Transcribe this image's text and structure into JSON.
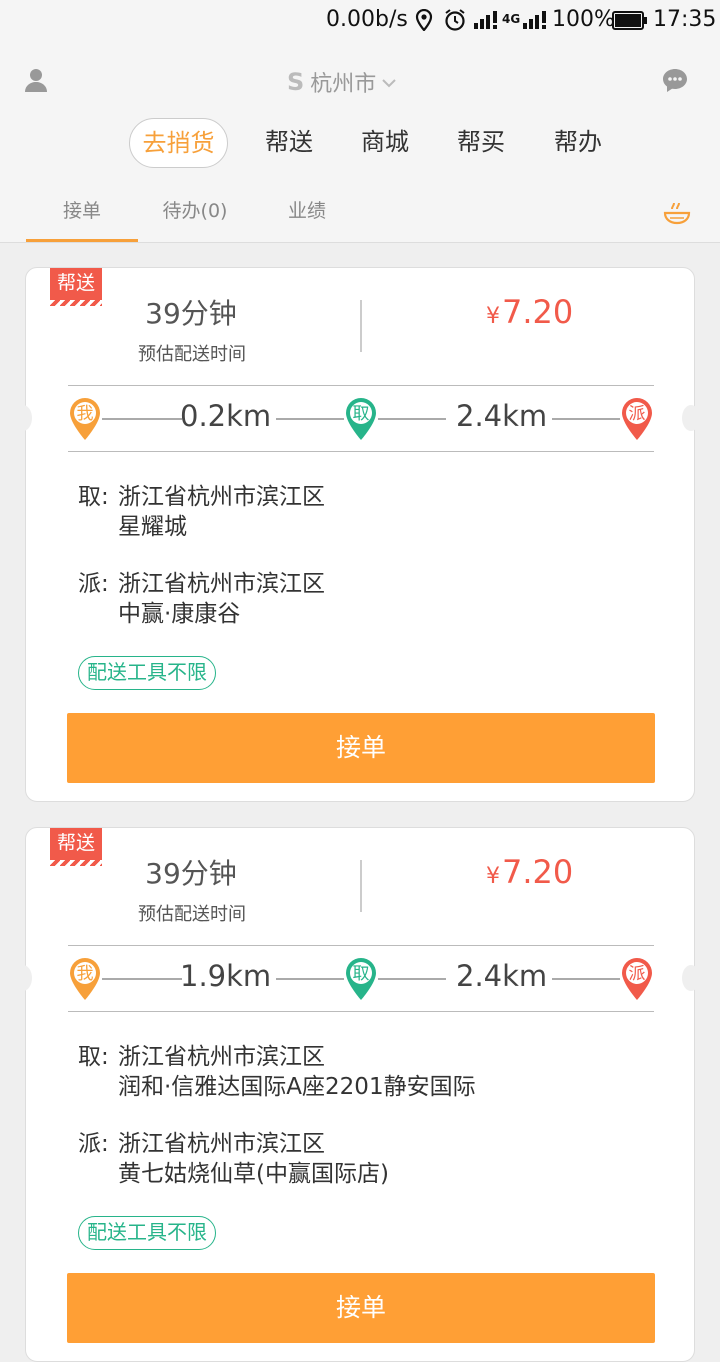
{
  "status_bar": {
    "speed": "0.00b/s",
    "network": "4G",
    "battery": "100%",
    "time": "17:35"
  },
  "header": {
    "city": "杭州市",
    "logo_letter": "S",
    "main_tabs": [
      {
        "label": "去捎货",
        "active": true
      },
      {
        "label": "帮送",
        "active": false
      },
      {
        "label": "商城",
        "active": false
      },
      {
        "label": "帮买",
        "active": false
      },
      {
        "label": "帮办",
        "active": false
      }
    ],
    "sub_tabs": [
      {
        "label": "接单",
        "active": true
      },
      {
        "label": "待办(0)",
        "active": false
      },
      {
        "label": "业绩",
        "active": false
      }
    ]
  },
  "orders": [
    {
      "tag": "帮送",
      "eta": "39分钟",
      "eta_label": "预估配送时间",
      "price": "7.20",
      "currency": "¥",
      "me_label": "我",
      "pickup_label": "取",
      "deliver_label": "派",
      "dist_me_pickup": "0.2km",
      "dist_pickup_deliver": "2.4km",
      "pickup_prefix": "取:",
      "pickup_line1": "浙江省杭州市滨江区",
      "pickup_line2": "星耀城",
      "deliver_prefix": "派:",
      "deliver_line1": "浙江省杭州市滨江区",
      "deliver_line2": "中赢·康康谷",
      "tool": "配送工具不限",
      "button": "接单"
    },
    {
      "tag": "帮送",
      "eta": "39分钟",
      "eta_label": "预估配送时间",
      "price": "7.20",
      "currency": "¥",
      "me_label": "我",
      "pickup_label": "取",
      "deliver_label": "派",
      "dist_me_pickup": "1.9km",
      "dist_pickup_deliver": "2.4km",
      "pickup_prefix": "取:",
      "pickup_line1": "浙江省杭州市滨江区",
      "pickup_line2": "润和·信雅达国际A座2201静安国际",
      "deliver_prefix": "派:",
      "deliver_line1": "浙江省杭州市滨江区",
      "deliver_line2": "黄七姑烧仙草(中赢国际店)",
      "tool": "配送工具不限",
      "button": "接单"
    }
  ],
  "colors": {
    "accent": "#f7a03a",
    "price": "#f15a4a",
    "tool_tag": "#27b48a",
    "pin_me": "#f7a03a",
    "pin_pickup": "#27b48a",
    "pin_deliver": "#f15a4a",
    "button": "#ff9f35"
  }
}
